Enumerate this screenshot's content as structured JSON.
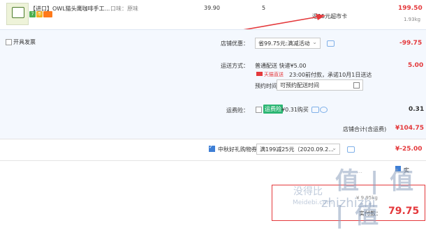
{
  "product": {
    "title": "【进口】OWL猫头鹰咖啡手工...",
    "flavor_label": "口味：原味",
    "unit_price": "39.90",
    "quantity": "5",
    "subtotal": "199.50",
    "weight": "1.93kg",
    "badges": [
      {
        "text": "7",
        "color": "#4caf50"
      },
      {
        "text": "币",
        "color": "#f2b01e"
      },
      {
        "text": "",
        "color": "#ff7a1a"
      }
    ]
  },
  "annotation": {
    "text": "返15元超市卡"
  },
  "invoice": {
    "label": "开具发票"
  },
  "shop_discount": {
    "label": "店铺优惠：",
    "select_value": "省99.75元:满减活动",
    "amount": "-99.75"
  },
  "delivery": {
    "label": "运送方式：",
    "method": "普通配送 快递¥5.00",
    "tmall_tag": "天猫直送",
    "promise": "23:00前付款，承诺10月1日送达",
    "reserve_label": "预约时间",
    "reserve_placeholder": "可预约配送时间",
    "fee": "5.00"
  },
  "insurance": {
    "label": "运费险：",
    "tag": "运费险",
    "text": "¥0.31购买",
    "amount": "0.31"
  },
  "shop_total": {
    "label": "店铺合计(含运费)",
    "amount": "¥104.75"
  },
  "coupon": {
    "label": "中秋好礼购物券",
    "select_value": "满199减25元（2020.09.2...",
    "amount": "¥-25.00"
  },
  "bottom": {
    "label_partial": "实付款：",
    "total_partial": "79.75",
    "weight_partial": "¥ 9.95kg"
  },
  "watermark": {
    "text1": "值 | 值 | 值",
    "text2": "zhizhizhi",
    "text3": "Meidebi.com",
    "text4": "没得比"
  },
  "colors": {
    "accent_red": "#e4393c",
    "link_blue": "#3e7fd6",
    "section_bg": "#f4f8fe",
    "arrow_red": "#e4393c"
  }
}
